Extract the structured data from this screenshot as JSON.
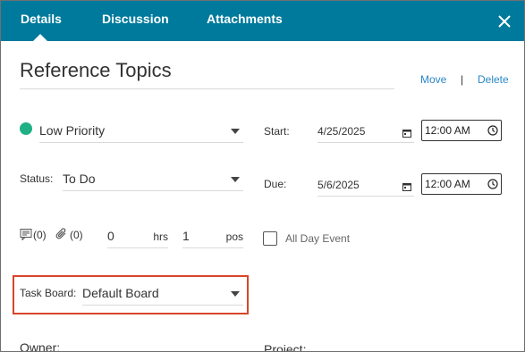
{
  "tabs": [
    {
      "label": "Details"
    },
    {
      "label": "Discussion"
    },
    {
      "label": "Attachments"
    }
  ],
  "title": "Reference Topics",
  "actions": {
    "move_label": "Move",
    "separator": "|",
    "delete_label": "Delete"
  },
  "priority": {
    "value": "Low Priority",
    "color": "#20b086"
  },
  "status": {
    "label": "Status:",
    "value": "To Do"
  },
  "start": {
    "label": "Start:",
    "date": "4/25/2025",
    "time": "12:00 AM"
  },
  "due": {
    "label": "Due:",
    "date": "5/6/2025",
    "time": "12:00 AM"
  },
  "counts": {
    "notes": "(0)",
    "attachments": "(0)"
  },
  "hours": {
    "value": "0",
    "unit": "hrs"
  },
  "position": {
    "value": "1",
    "unit": "pos"
  },
  "all_day": {
    "label": "All Day Event",
    "checked": false
  },
  "task_board": {
    "label": "Task Board:",
    "value": "Default Board"
  },
  "bottom": {
    "owner_label": "Owner:",
    "project_label": "Project:"
  },
  "colors": {
    "header": "#007a9c",
    "accent_link": "#2a87c6",
    "highlight": "#d9452b"
  }
}
